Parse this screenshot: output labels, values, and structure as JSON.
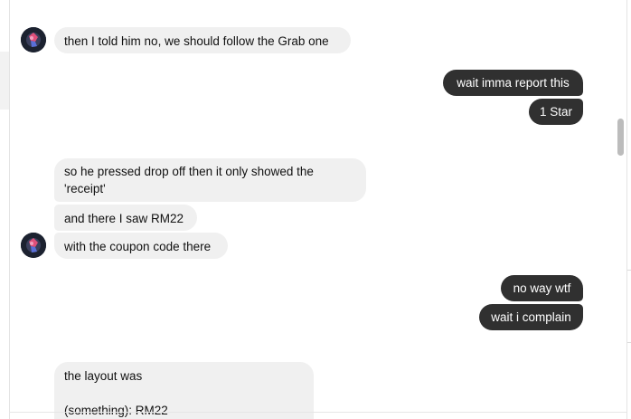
{
  "messages": [
    {
      "side": "in",
      "text": "then I told him no, we should follow the Grab one",
      "avatar": "contact-avatar"
    },
    {
      "side": "out",
      "text": "wait imma report this"
    },
    {
      "side": "out",
      "text": "1 Star"
    },
    {
      "side": "in",
      "text": "so he pressed drop off then it only showed the\n'receipt'"
    },
    {
      "side": "in",
      "text": "and there I saw RM22"
    },
    {
      "side": "in",
      "text": "with the coupon code there",
      "avatar": "contact-avatar"
    },
    {
      "side": "out",
      "text": "no way wtf"
    },
    {
      "side": "out",
      "text": "wait i complain"
    },
    {
      "side": "in",
      "text": "the layout was\n\n(something): RM22"
    }
  ],
  "colors": {
    "incoming_bubble": "#f0f0f0",
    "outgoing_bubble": "#303030",
    "outgoing_text": "#ffffff",
    "scrollbar": "#bcbcbc"
  }
}
